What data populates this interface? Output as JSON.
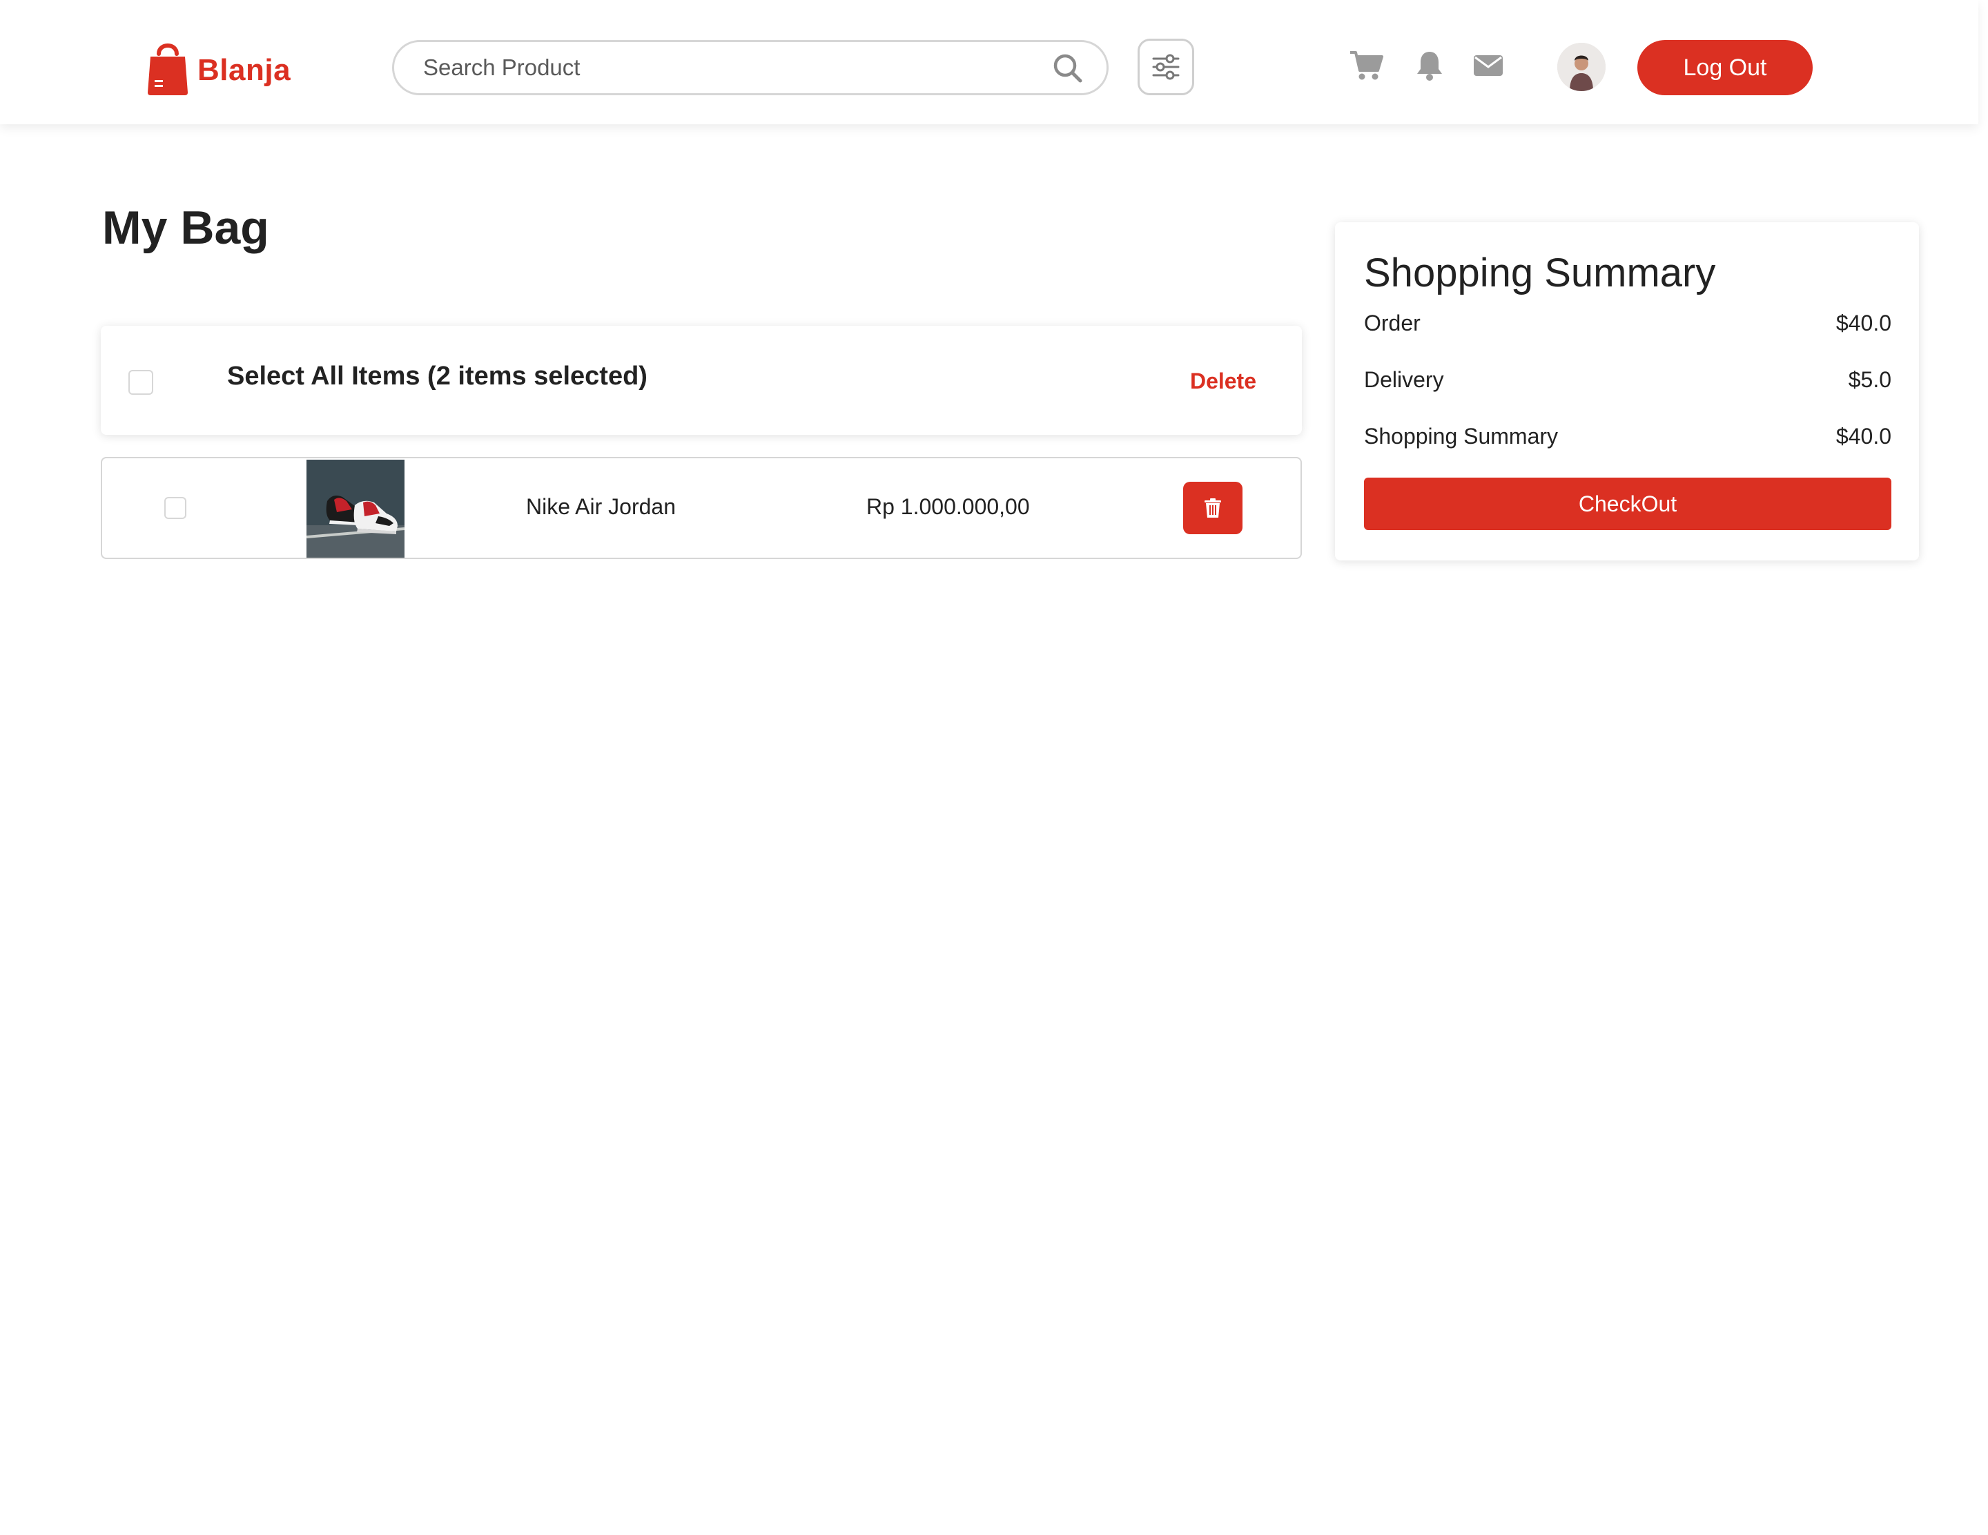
{
  "navbar": {
    "brand": "Blanja",
    "search": {
      "placeholder": "Search Product",
      "value": ""
    },
    "icons": [
      "search-icon",
      "filter-icon",
      "cart-icon",
      "bell-icon",
      "mail-icon"
    ],
    "logout_label": "Log Out"
  },
  "page": {
    "title": "My Bag"
  },
  "selection": {
    "select_all_label": "Select All Items (2 items selected)",
    "delete_label": "Delete",
    "checked": false
  },
  "cart": {
    "items": [
      {
        "name": "Nike Air Jordan",
        "price": "Rp 1.000.000,00",
        "checked": false
      }
    ]
  },
  "summary": {
    "title": "Shopping Summary",
    "rows": [
      {
        "label": "Order",
        "value": "$40.0"
      },
      {
        "label": "Delivery",
        "value": "$5.0"
      },
      {
        "label": "Shopping Summary",
        "value": "$40.0"
      }
    ],
    "checkout_label": "CheckOut"
  },
  "colors": {
    "primary": "#DB3022",
    "text": "#222222",
    "icon_gray": "#9b9b9b",
    "border": "#d6d6d6"
  }
}
